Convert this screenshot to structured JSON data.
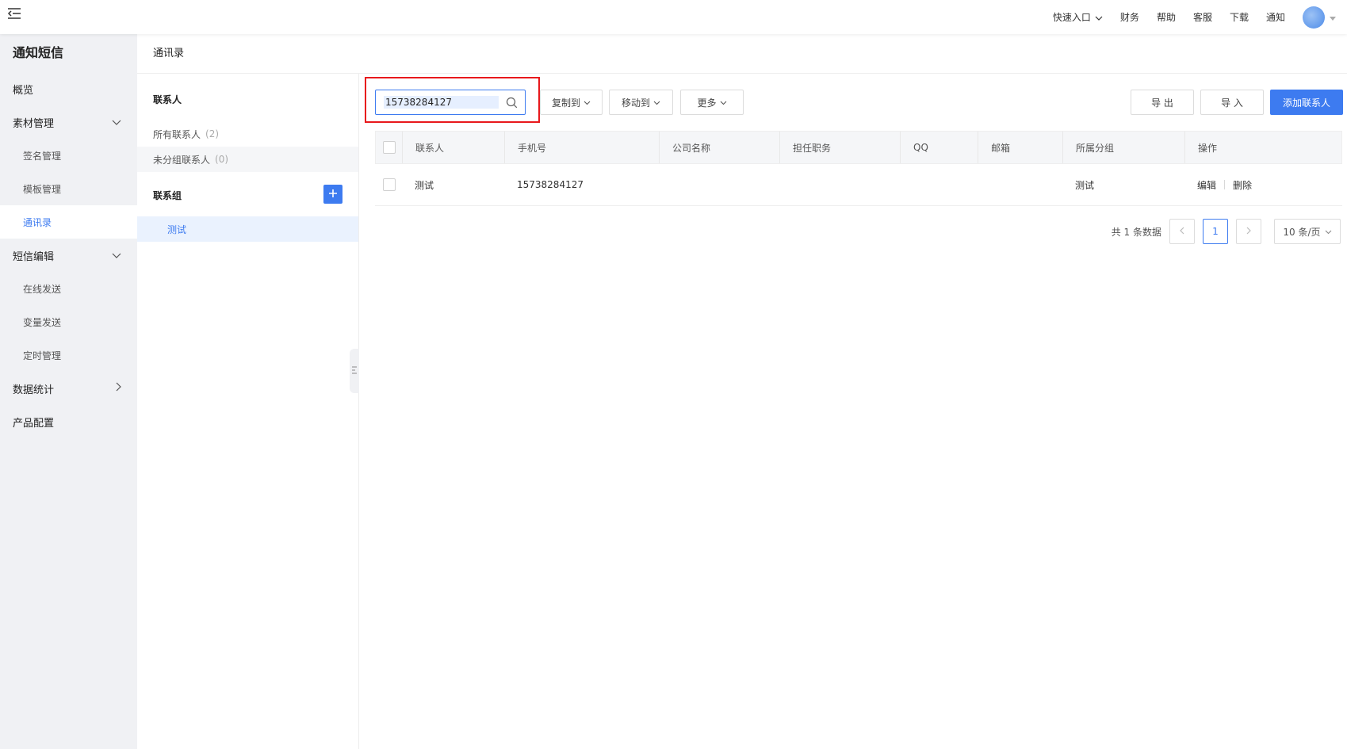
{
  "topbar": {
    "nav": [
      {
        "label": "快速入口",
        "has_dropdown": true
      },
      {
        "label": "财务"
      },
      {
        "label": "帮助"
      },
      {
        "label": "客服"
      },
      {
        "label": "下载"
      },
      {
        "label": "通知"
      }
    ]
  },
  "sidebar": {
    "title": "通知短信",
    "items": [
      {
        "label": "概览"
      },
      {
        "label": "素材管理",
        "expanded": true
      },
      {
        "label": "签名管理"
      },
      {
        "label": "模板管理"
      },
      {
        "label": "通讯录",
        "active": true
      },
      {
        "label": "短信编辑",
        "expanded": true
      },
      {
        "label": "在线发送"
      },
      {
        "label": "变量发送"
      },
      {
        "label": "定时管理"
      },
      {
        "label": "数据统计",
        "expanded": false
      },
      {
        "label": "产品配置"
      }
    ]
  },
  "page": {
    "title": "通讯录"
  },
  "contacts_panel": {
    "contacts_heading": "联系人",
    "all_contacts": {
      "label": "所有联系人",
      "count": "(2)"
    },
    "ungrouped": {
      "label": "未分组联系人",
      "count": "(0)"
    },
    "groups_heading": "联系组",
    "groups": [
      {
        "label": "测试",
        "active": true
      }
    ]
  },
  "toolbar": {
    "search_value": "15738284127",
    "copy_to": "复制到",
    "move_to": "移动到",
    "more": "更多",
    "export": "导 出",
    "import": "导 入",
    "add_contact": "添加联系人"
  },
  "table": {
    "columns": [
      "联系人",
      "手机号",
      "公司名称",
      "担任职务",
      "QQ",
      "邮箱",
      "所属分组",
      "操作"
    ],
    "rows": [
      {
        "contact": "测试",
        "phone": "15738284127",
        "company": "",
        "position": "",
        "qq": "",
        "email": "",
        "group": "测试",
        "edit": "编辑",
        "delete": "删除"
      }
    ]
  },
  "pagination": {
    "total": "共 1 条数据",
    "current_page": "1",
    "page_size": "10 条/页"
  },
  "colors": {
    "primary": "#3d7bf0",
    "highlight_border": "#e8181c",
    "sidebar_bg": "#f0f1f4"
  }
}
